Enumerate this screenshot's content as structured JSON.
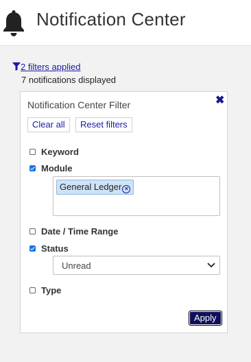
{
  "header": {
    "title": "Notification Center",
    "icon": "bell-icon"
  },
  "summary": {
    "filters_link": "2 filters applied",
    "count_text": "7 notifications displayed"
  },
  "panel": {
    "title": "Notification Center Filter",
    "clear_label": "Clear all",
    "reset_label": "Reset filters",
    "filters": [
      {
        "label": "Keyword",
        "checked": false
      },
      {
        "label": "Module",
        "checked": true
      },
      {
        "label": "Date / Time Range",
        "checked": false
      },
      {
        "label": "Status",
        "checked": true
      },
      {
        "label": "Type",
        "checked": false
      }
    ],
    "module_tags": [
      "General Ledger"
    ],
    "status_value": "Unread",
    "apply_label": "Apply"
  },
  "colors": {
    "link": "#1a1aa6",
    "apply_bg": "#0f0f5a",
    "tag_bg": "#cfe3f7",
    "checkbox_on": "#1a73e8"
  }
}
